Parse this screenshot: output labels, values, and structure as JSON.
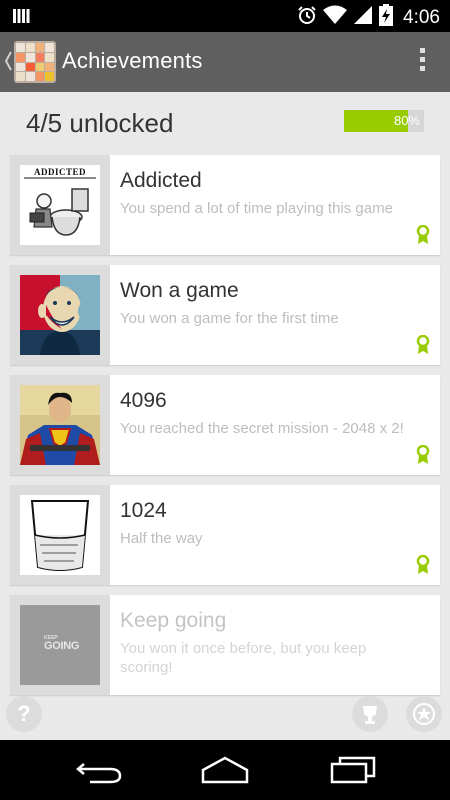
{
  "status_bar": {
    "time": "4:06",
    "icons": [
      "notification-bars-icon",
      "alarm-icon",
      "wifi-icon",
      "signal-icon",
      "battery-charging-icon"
    ]
  },
  "action_bar": {
    "title": "Achievements",
    "icons": [
      "back-chevron-icon",
      "app-2048-icon",
      "overflow-menu-icon"
    ]
  },
  "summary": {
    "text": "4/5 unlocked",
    "progress_label": "80%",
    "progress_value": 0.8,
    "progress_color": "#99cc00"
  },
  "achievements": [
    {
      "name": "Addicted",
      "description": "You spend a lot of time playing this game",
      "unlocked": true,
      "thumb_caption": "ADDICTED"
    },
    {
      "name": "Won a game",
      "description": "You won a game for the first time",
      "unlocked": true
    },
    {
      "name": "4096",
      "description": "You reached the secret mission - 2048 x 2!",
      "unlocked": true
    },
    {
      "name": "1024",
      "description": "Half the way",
      "unlocked": true
    },
    {
      "name": "Keep going",
      "description": "You won it once before, but you keep scoring!",
      "unlocked": false,
      "thumb_caption_small": "KEEP",
      "thumb_caption": "GOING"
    }
  ],
  "bottom_icons": [
    "help-icon",
    "trophy-icon",
    "star-icon"
  ],
  "nav_bar": {
    "icons": [
      "back-icon",
      "home-icon",
      "recent-apps-icon"
    ]
  }
}
